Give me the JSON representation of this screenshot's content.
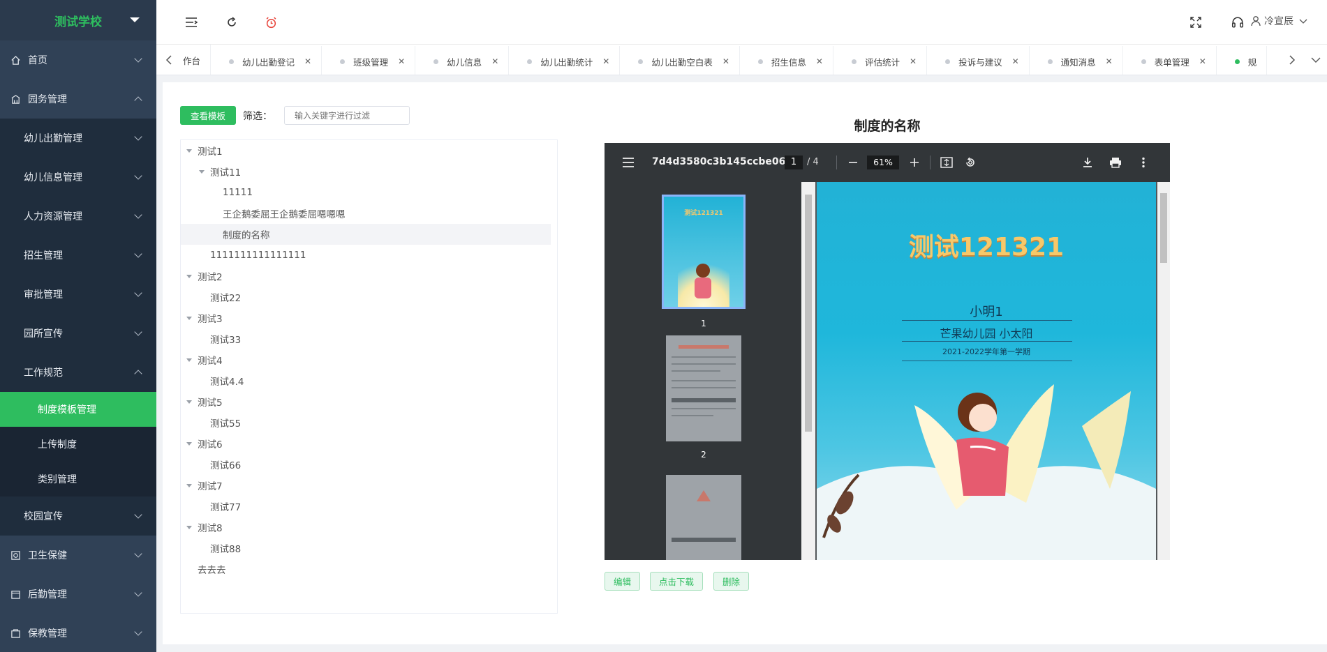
{
  "sidebar": {
    "brand": "测试学校",
    "items": [
      {
        "label": "首页"
      },
      {
        "label": "园务管理"
      },
      {
        "label": "卫生保健"
      },
      {
        "label": "后勤管理"
      },
      {
        "label": "保教管理"
      }
    ],
    "sub_items": [
      {
        "label": "幼儿出勤管理"
      },
      {
        "label": "幼儿信息管理"
      },
      {
        "label": "人力资源管理"
      },
      {
        "label": "招生管理"
      },
      {
        "label": "审批管理"
      },
      {
        "label": "园所宣传"
      },
      {
        "label": "工作规范"
      },
      {
        "label": "校园宣传"
      }
    ],
    "sub2_items": [
      {
        "label": "制度模板管理"
      },
      {
        "label": "上传制度"
      },
      {
        "label": "类别管理"
      }
    ]
  },
  "header": {
    "user_name": "冷宣辰"
  },
  "tabs": [
    {
      "label": "作台"
    },
    {
      "label": "幼儿出勤登记"
    },
    {
      "label": "班级管理"
    },
    {
      "label": "幼儿信息"
    },
    {
      "label": "幼儿出勤统计"
    },
    {
      "label": "幼儿出勤空白表"
    },
    {
      "label": "招生信息"
    },
    {
      "label": "评估统计"
    },
    {
      "label": "投诉与建议"
    },
    {
      "label": "通知消息"
    },
    {
      "label": "表单管理"
    },
    {
      "label": "规"
    }
  ],
  "toolbar": {
    "view_template": "查看模板",
    "filter_label": "筛选：",
    "filter_placeholder": "输入关键字进行过滤"
  },
  "tree": [
    {
      "label": "测试1"
    },
    {
      "label": "测试11"
    },
    {
      "label": "11111"
    },
    {
      "label": "王企鹅委屈王企鹅委屈嗯嗯嗯"
    },
    {
      "label": "制度的名称"
    },
    {
      "label": "1111111111111111"
    },
    {
      "label": "测试2"
    },
    {
      "label": "测试22"
    },
    {
      "label": "测试3"
    },
    {
      "label": "测试33"
    },
    {
      "label": "测试4"
    },
    {
      "label": "测试4.4"
    },
    {
      "label": "测试5"
    },
    {
      "label": "测试55"
    },
    {
      "label": "测试6"
    },
    {
      "label": "测试66"
    },
    {
      "label": "测试7"
    },
    {
      "label": "测试77"
    },
    {
      "label": "测试8"
    },
    {
      "label": "测试88"
    },
    {
      "label": "去去去"
    }
  ],
  "document": {
    "title": "制度的名称"
  },
  "pdf": {
    "filename": "7d4d3580c3b145ccbe06...",
    "current_page": "1",
    "page_of": "/  4",
    "zoom": "61%",
    "thumb_labels": [
      "1",
      "2"
    ],
    "page_title": "测试121321",
    "page_name": "小明1",
    "page_school": "芒果幼儿园 小太阳",
    "page_term": "2021-2022学年第一学期",
    "thumb1_title": "测试121321"
  },
  "actions": {
    "edit": "编辑",
    "download": "点击下载",
    "delete": "删除"
  },
  "colors": {
    "accent": "#2ebd5f",
    "sidebar_bg": "#304156"
  }
}
